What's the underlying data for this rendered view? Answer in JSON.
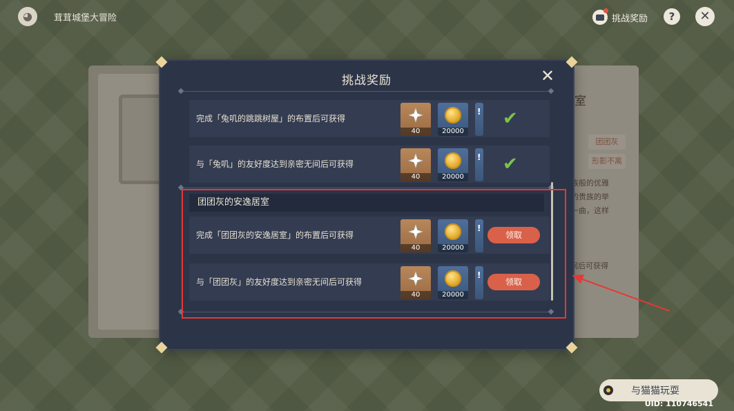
{
  "app": {
    "title": "茸茸城堡大冒险"
  },
  "topbar": {
    "challenge_reward_label": "挑战奖励"
  },
  "background": {
    "right_card": {
      "title": "室",
      "tags": [
        "团团灰",
        "形影不离"
      ],
      "lines": [
        "族般的优雅",
        "的贵族的举",
        "一曲，这样"
      ],
      "condition": "间后可获得"
    },
    "play_button_label": "与猫猫玩耍",
    "uid": "UID: 110746541"
  },
  "modal": {
    "title": "挑战奖励",
    "rows_top": [
      {
        "text": "完成「兔叽的跳跳树屋」的布置后可获得",
        "rewards": [
          "40",
          "20000"
        ],
        "status": "claimed"
      },
      {
        "text": "与「兔叽」的友好度达到亲密无间后可获得",
        "rewards": [
          "40",
          "20000"
        ],
        "status": "claimed"
      }
    ],
    "section": {
      "title": "团团灰的安逸居室",
      "rows": [
        {
          "text": "完成「团团灰的安逸居室」的布置后可获得",
          "rewards": [
            "40",
            "20000"
          ],
          "button": "领取"
        },
        {
          "text": "与「团团灰」的友好度达到亲密无间后可获得",
          "rewards": [
            "40",
            "20000"
          ],
          "button": "领取"
        }
      ]
    }
  },
  "colors": {
    "accent_red": "#e53935",
    "claim_button": "#d9614a",
    "check_green": "#7ec24a",
    "modal_bg": "#2c3448"
  }
}
